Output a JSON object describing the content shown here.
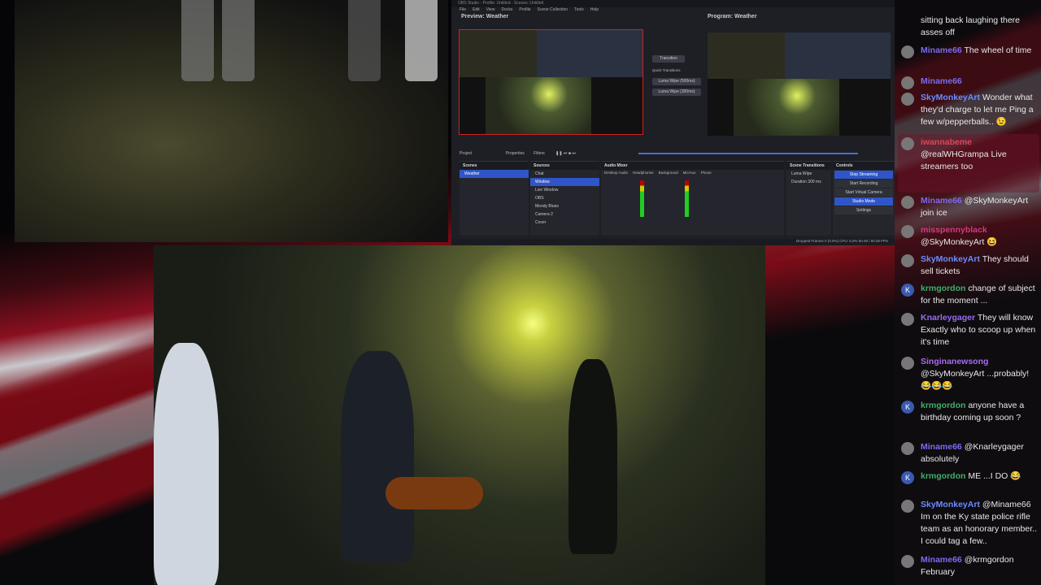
{
  "obs": {
    "title": "OBS Studio - Profile: Untitled - Scenes: Untitled",
    "menu": [
      "File",
      "Edit",
      "View",
      "Docks",
      "Profile",
      "Scene Collection",
      "Tools",
      "Help"
    ],
    "preview_label": "Preview: Weather",
    "program_label": "Program: Weather",
    "transition_button": "Transition",
    "quick_transitions": "Quick Transitions",
    "quick_items": [
      "Luma Wipe (500ms)",
      "Luma Wipe (300ms)"
    ],
    "toolbar": {
      "project": "Project",
      "properties": "Properties",
      "filters": "Filters"
    },
    "scenes_header": "Scenes",
    "scenes": [
      "Weather"
    ],
    "sources_header": "Sources",
    "sources": [
      "Chat",
      "Window",
      "Live Window",
      "OBS",
      "Moody Blues",
      "Camera 2",
      "Cover"
    ],
    "mixer_header": "Audio Mixer",
    "mixer": [
      "Desktop Audio",
      "Headphones",
      "Background",
      "Mic/Aux",
      "Phone"
    ],
    "transitions_header": "Scene Transitions",
    "transition_type": "Luma Wipe",
    "duration_label": "Duration",
    "duration": "300 ms",
    "controls_header": "Controls",
    "controls": [
      "Stop Streaming",
      "Start Recording",
      "Start Virtual Camera",
      "Studio Mode",
      "Settings"
    ],
    "status": "Dropped Frames 0 (0.0%)   CPU: 5.0%   60.00 / 60.00 FPS"
  },
  "chat": [
    {
      "user": "",
      "color": "#ddd",
      "text": "sitting back laughing there asses off"
    },
    {
      "user": "Miname66",
      "color": "#7b6bf0",
      "text": "The wheel of time"
    },
    {
      "user": "Miname66",
      "color": "#7b6bf0",
      "text": ""
    },
    {
      "user": "SkyMonkeyArt",
      "color": "#6a8cff",
      "text": "Wonder what they'd charge to let me Ping a few w/pepperballs.. 😉"
    },
    {
      "user": "iwannabeme",
      "color": "#e0455a",
      "text": "@realWHGrampa Live streamers too"
    },
    {
      "user": "Miname66",
      "color": "#7b6bf0",
      "text": "@SkyMonkeyArt join ice"
    },
    {
      "user": "misspennyblack",
      "color": "#d03a80",
      "text": "@SkyMonkeyArt 😆"
    },
    {
      "user": "SkyMonkeyArt",
      "color": "#6a8cff",
      "text": "They should sell tickets"
    },
    {
      "user": "krmgordon",
      "color": "#3fae6a",
      "text": "change of subject for the moment ..."
    },
    {
      "user": "Knarleygager",
      "color": "#9a6bf0",
      "text": "They will know Exactly who to scoop up when it's time"
    },
    {
      "user": "Singinanewsong",
      "color": "#a76bf0",
      "text": "@SkyMonkeyArt ...probably! 😂😂😂"
    },
    {
      "user": "krmgordon",
      "color": "#3fae6a",
      "text": "anyone have a birthday coming up soon ?"
    },
    {
      "user": "Miname66",
      "color": "#7b6bf0",
      "text": "@Knarleygager absolutely"
    },
    {
      "user": "krmgordon",
      "color": "#3fae6a",
      "text": "ME ...I DO 😂"
    },
    {
      "user": "SkyMonkeyArt",
      "color": "#6a8cff",
      "text": "@Miname66 Im on the Ky state police rifle team as an honorary member.. I could tag a few.."
    },
    {
      "user": "Miname66",
      "color": "#7b6bf0",
      "text": "@krmgordon February"
    }
  ]
}
